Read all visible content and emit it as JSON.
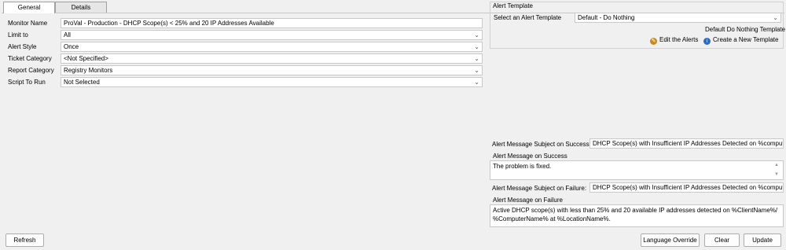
{
  "tabs": [
    {
      "label": "General",
      "active": true
    },
    {
      "label": "Details",
      "active": false
    }
  ],
  "form": {
    "monitor_name": {
      "label": "Monitor Name",
      "value": "ProVal - Production - DHCP Scope(s) < 25% and 20 IP Addresses Available"
    },
    "limit_to": {
      "label": "Limit to",
      "value": "All"
    },
    "alert_style": {
      "label": "Alert Style",
      "value": "Once"
    },
    "ticket_category": {
      "label": "Ticket Category",
      "value": "<Not Specified>"
    },
    "report_category": {
      "label": "Report Category",
      "value": "Registry Monitors"
    },
    "script_to_run": {
      "label": "Script To Run",
      "value": "Not Selected"
    }
  },
  "alert_template": {
    "group_title": "Alert Template",
    "select_label": "Select an Alert Template",
    "selected": "Default - Do Nothing",
    "template_name": "Default Do Nothing Template",
    "edit_alerts_label": "Edit the Alerts",
    "create_template_label": "Create a New Template"
  },
  "messages": {
    "subject_success_label": "Alert Message Subject on Success:",
    "subject_success_value": "DHCP Scope(s) with Insufficient IP Addresses Detected on %computername",
    "success_label": "Alert Message on Success",
    "success_value": "The problem is fixed.",
    "subject_failure_label": "Alert Message Subject on Failure:",
    "subject_failure_value": "DHCP Scope(s) with Insufficient IP Addresses Detected on %computernar",
    "failure_label": "Alert Message on Failure",
    "failure_line1": "Active DHCP scope(s) with less than 25% and 20 available IP addresses detected on %ClientName%/",
    "failure_line2": "%ComputerName% at %LocationName%."
  },
  "buttons": {
    "refresh": "Refresh",
    "language_override": "Language Override",
    "clear": "Clear",
    "update": "Update"
  },
  "icons": {
    "dropdown": "chevron-down-icon",
    "edit_alerts": "edit-alerts-icon",
    "create_template": "info-icon"
  },
  "colors": {
    "background": "#f0f0f0",
    "edit_icon": "#c98a1b",
    "info_icon": "#2d6bc4"
  }
}
